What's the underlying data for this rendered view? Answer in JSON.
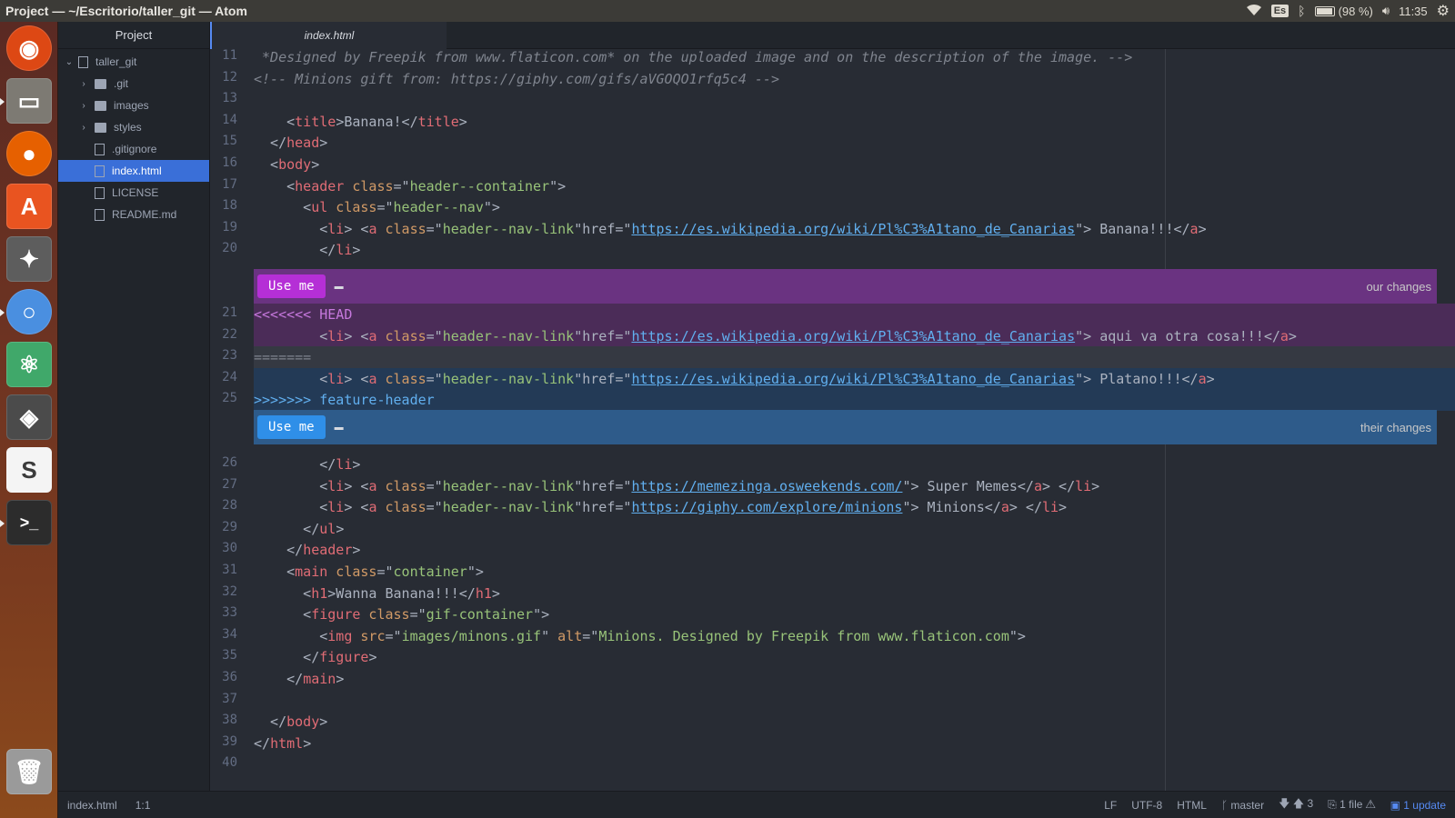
{
  "window": {
    "title": "Project — ~/Escritorio/taller_git — Atom"
  },
  "systray": {
    "keyboard": "Es",
    "battery": "(98 %)",
    "time": "11:35"
  },
  "launcher": {
    "items": [
      "ubuntu-logo-icon",
      "files-icon",
      "firefox-icon",
      "software-center-icon",
      "settings-icon",
      "chromium-icon",
      "atom-icon",
      "gimp-icon",
      "slack-icon",
      "terminal-icon",
      "trash-icon"
    ]
  },
  "tree": {
    "header": "Project",
    "root": "taller_git",
    "items": [
      {
        "label": ".git",
        "type": "folder"
      },
      {
        "label": "images",
        "type": "folder"
      },
      {
        "label": "styles",
        "type": "folder"
      },
      {
        "label": ".gitignore",
        "type": "file"
      },
      {
        "label": "index.html",
        "type": "file",
        "selected": true
      },
      {
        "label": "LICENSE",
        "type": "file"
      },
      {
        "label": "README.md",
        "type": "file"
      }
    ]
  },
  "tabs": [
    {
      "label": "index.html",
      "active": true
    }
  ],
  "editor": {
    "lines": [
      {
        "n": "11",
        "text": " *Designed by Freepik from www.flaticon.com* on the uploaded image and on the description of the image. -->"
      },
      {
        "n": "12",
        "text": "<!-- Minions gift from: https://giphy.com/gifs/aVGOQO1rfq5c4 -->"
      },
      {
        "n": "13",
        "text": ""
      },
      {
        "n": "14",
        "text": "    <title>Banana!</title>"
      },
      {
        "n": "15",
        "text": "  </head>"
      },
      {
        "n": "16",
        "text": "  <body>"
      },
      {
        "n": "17",
        "text": "    <header class=\"header--container\">"
      },
      {
        "n": "18",
        "text": "      <ul class=\"header--nav\">"
      },
      {
        "n": "19",
        "text": "        <li> <a class=\"header--nav-link\"href=\"https://es.wikipedia.org/wiki/Pl%C3%A1tano_de_Canarias\"> Banana!!!</a>"
      },
      {
        "n": "20",
        "text": "        </li>"
      },
      {
        "n": "21",
        "text": "<<<<<<< HEAD"
      },
      {
        "n": "22",
        "text": "        <li> <a class=\"header--nav-link\"href=\"https://es.wikipedia.org/wiki/Pl%C3%A1tano_de_Canarias\"> aqui va otra cosa!!!</a>"
      },
      {
        "n": "23",
        "text": "======="
      },
      {
        "n": "24",
        "text": "        <li> <a class=\"header--nav-link\"href=\"https://es.wikipedia.org/wiki/Pl%C3%A1tano_de_Canarias\"> Platano!!!</a>"
      },
      {
        "n": "25",
        "text": ">>>>>>> feature-header"
      },
      {
        "n": "26",
        "text": "        </li>"
      },
      {
        "n": "27",
        "text": "        <li> <a class=\"header--nav-link\"href=\"https://memezinga.osweekends.com/\"> Super Memes</a> </li>"
      },
      {
        "n": "28",
        "text": "        <li> <a class=\"header--nav-link\"href=\"https://giphy.com/explore/minions\"> Minions</a> </li>"
      },
      {
        "n": "29",
        "text": "      </ul>"
      },
      {
        "n": "30",
        "text": "    </header>"
      },
      {
        "n": "31",
        "text": "    <main class=\"container\">"
      },
      {
        "n": "32",
        "text": "      <h1>Wanna Banana!!!</h1>"
      },
      {
        "n": "33",
        "text": "      <figure class=\"gif-container\">"
      },
      {
        "n": "34",
        "text": "        <img src=\"images/minons.gif\" alt=\"Minions. Designed by Freepik from www.flaticon.com\">"
      },
      {
        "n": "35",
        "text": "      </figure>"
      },
      {
        "n": "36",
        "text": "    </main>"
      },
      {
        "n": "37",
        "text": ""
      },
      {
        "n": "38",
        "text": "  </body>"
      },
      {
        "n": "39",
        "text": "</html>"
      },
      {
        "n": "40",
        "text": ""
      }
    ],
    "conflict": {
      "ours": {
        "button": "Use me",
        "label": "our changes"
      },
      "theirs": {
        "button": "Use me",
        "label": "their changes"
      }
    }
  },
  "status": {
    "file": "index.html",
    "cursor": "1:1",
    "line_ending": "LF",
    "encoding": "UTF-8",
    "grammar": "HTML",
    "branch": "master",
    "ahead": "3",
    "changed": "1 file",
    "update": "1 update"
  }
}
